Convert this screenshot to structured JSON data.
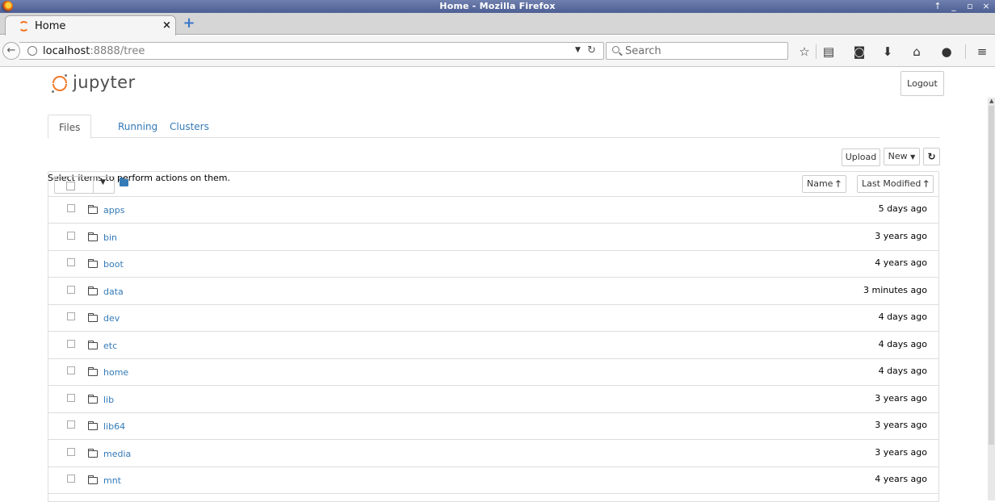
{
  "window": {
    "title": "Home - Mozilla Firefox",
    "controls": [
      "↑",
      "_",
      "▫",
      "×"
    ]
  },
  "browser": {
    "tab_title": "Home",
    "url_host": "localhost",
    "url_path": ":8888/tree",
    "search_placeholder": "Search"
  },
  "header": {
    "logo_text": "jupyter",
    "logout_label": "Logout"
  },
  "tabs": [
    {
      "label": "Files",
      "active": true
    },
    {
      "label": "Running",
      "active": false
    },
    {
      "label": "Clusters",
      "active": false
    }
  ],
  "toolbar": {
    "hint": "Select items to perform actions on them.",
    "upload_label": "Upload",
    "new_label": "New"
  },
  "list_header": {
    "name_label": "Name",
    "modified_label": "Last Modified"
  },
  "rows": [
    {
      "name": "apps",
      "modified": "5 days ago"
    },
    {
      "name": "bin",
      "modified": "3 years ago"
    },
    {
      "name": "boot",
      "modified": "4 years ago"
    },
    {
      "name": "data",
      "modified": "3 minutes ago"
    },
    {
      "name": "dev",
      "modified": "4 days ago"
    },
    {
      "name": "etc",
      "modified": "4 days ago"
    },
    {
      "name": "home",
      "modified": "4 days ago"
    },
    {
      "name": "lib",
      "modified": "3 years ago"
    },
    {
      "name": "lib64",
      "modified": "3 years ago"
    },
    {
      "name": "media",
      "modified": "3 years ago"
    },
    {
      "name": "mnt",
      "modified": "4 years ago"
    }
  ],
  "colors": {
    "link": "#337ab7",
    "jupyter_orange": "#f37726"
  }
}
